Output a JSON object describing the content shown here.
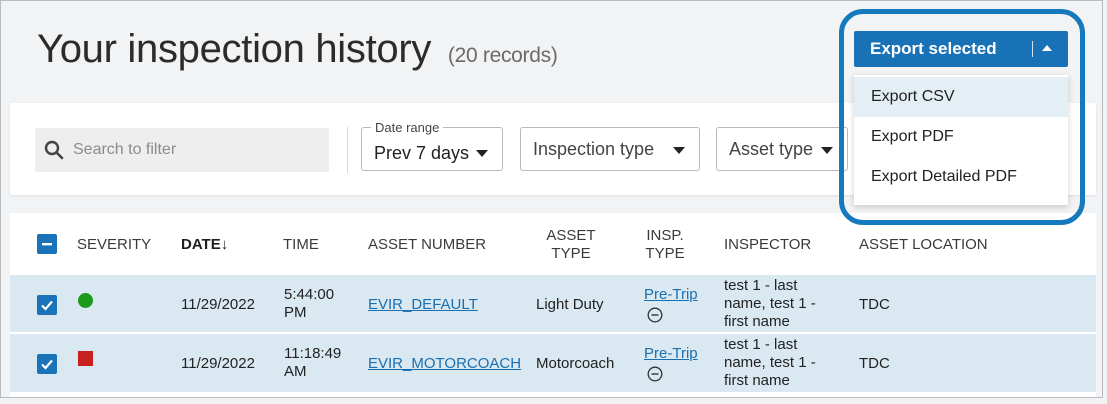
{
  "header": {
    "title": "Your inspection history",
    "record_count": "(20 records)"
  },
  "filters": {
    "search_placeholder": "Search to filter",
    "date_range_legend": "Date range",
    "date_range_value": "Prev 7 days",
    "inspection_type": "Inspection type",
    "asset_type": "Asset type"
  },
  "export": {
    "button_label": "Export selected",
    "menu": [
      "Export CSV",
      "Export PDF",
      "Export Detailed PDF"
    ],
    "highlighted_item": "Export CSV",
    "accent_color": "#1a72b6"
  },
  "table": {
    "columns": {
      "severity": "SEVERITY",
      "date": "DATE",
      "date_sort": "↓",
      "time": "TIME",
      "asset_number": "ASSET NUMBER",
      "asset_type_1": "ASSET",
      "asset_type_2": "TYPE",
      "insp_type_1": "INSP.",
      "insp_type_2": "TYPE",
      "inspector": "INSPECTOR",
      "asset_location": "ASSET LOCATION"
    },
    "rows": [
      {
        "selected": true,
        "severity": "green",
        "date": "11/29/2022",
        "time_1": "5:44:00",
        "time_2": "PM",
        "asset_number": "EVIR_DEFAULT",
        "asset_type": "Light Duty",
        "insp_type": "Pre-Trip",
        "inspector_1": "test 1 - last",
        "inspector_2": "name, test 1 -",
        "inspector_3": "first name",
        "location": "TDC"
      },
      {
        "selected": true,
        "severity": "red",
        "date": "11/29/2022",
        "time_1": "11:18:49",
        "time_2": "AM",
        "asset_number": "EVIR_MOTORCOACH",
        "asset_type": "Motorcoach",
        "insp_type": "Pre-Trip",
        "inspector_1": "test 1 - last",
        "inspector_2": "name, test 1 -",
        "inspector_3": "first name",
        "location": "TDC"
      }
    ]
  }
}
